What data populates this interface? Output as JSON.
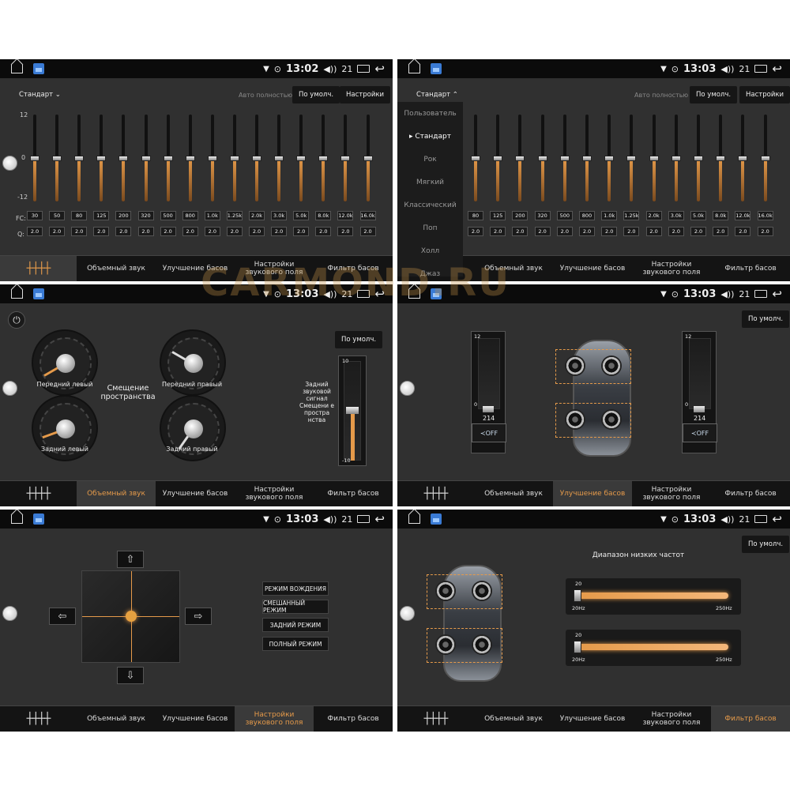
{
  "status": {
    "time1": "13:02",
    "time": "13:03",
    "volume": "21"
  },
  "tabs": {
    "surround": "Объемный звук",
    "bass": "Улучшение басов",
    "field": "Настройки звукового поля",
    "filter": "Фильтр басов"
  },
  "eq": {
    "preset": "Стандарт",
    "auto": "Авто полностью",
    "default_btn": "По умолч.",
    "settings_btn": "Настройки",
    "scale": {
      "top": "12",
      "mid": "0",
      "bottom": "-12"
    },
    "fc_label": "FC:",
    "q_label": "Q:",
    "fc": [
      "30",
      "50",
      "80",
      "125",
      "200",
      "320",
      "500",
      "800",
      "1.0k",
      "1.25k",
      "2.0k",
      "3.0k",
      "5.0k",
      "8.0k",
      "12.0k",
      "16.0k"
    ],
    "q": [
      "2.0",
      "2.0",
      "2.0",
      "2.0",
      "2.0",
      "2.0",
      "2.0",
      "2.0",
      "2.0",
      "2.0",
      "2.0",
      "2.0",
      "2.0",
      "2.0",
      "2.0",
      "2.0"
    ],
    "levels": [
      0,
      0,
      0,
      0,
      0,
      0,
      0,
      0,
      0,
      0,
      0,
      0,
      0,
      0,
      0,
      0
    ]
  },
  "presets": [
    "Пользователь",
    "Стандарт",
    "Рок",
    "Мягкий",
    "Классический",
    "Поп",
    "Холл",
    "Джаз"
  ],
  "surround": {
    "default_btn": "По умолч.",
    "center_label": "Смещение пространства",
    "front_left": "Передний левый",
    "front_right": "Передний правый",
    "rear_left": "Задний левый",
    "rear_right": "Задний правый",
    "rear_signal": "Задний звуковой сигнал Смещени е простра нства",
    "slider_top": "10",
    "slider_bottom": "-10"
  },
  "bass": {
    "default_btn": "По умолч.",
    "value": "214",
    "off": "OFF",
    "top": "12",
    "bottom": "0"
  },
  "field": {
    "modes": [
      "РЕЖИМ ВОЖДЕНИЯ",
      "СМЕШАННЫЙ РЕЖИМ",
      "ЗАДНИЙ РЕЖИМ",
      "ПОЛНЫЙ РЕЖИМ"
    ]
  },
  "filter": {
    "default_btn": "По умолч.",
    "title": "Диапазон низких частот",
    "value": "20",
    "min": "20Hz",
    "max": "250Hz"
  },
  "watermark": "CARMOND.RU",
  "colors": {
    "accent": "#e59a4a",
    "panel": "#303030",
    "statusbar": "#0b0b0b"
  }
}
